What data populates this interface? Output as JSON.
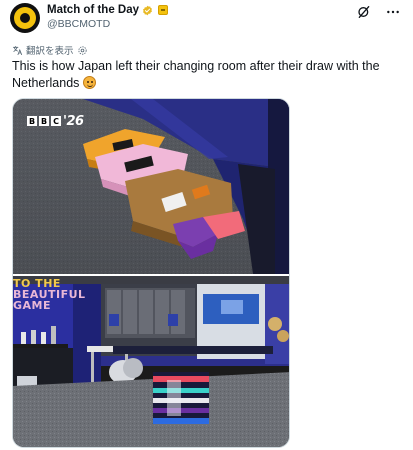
{
  "account": {
    "display_name": "Match of the Day",
    "handle": "@BBCMOTD"
  },
  "translate": {
    "label": "翻訳を表示"
  },
  "post": {
    "text": "This is how Japan left their changing room after their draw with the Netherlands"
  },
  "media": {
    "top_image": {
      "broadcaster_letters": [
        "B",
        "B",
        "C"
      ],
      "tournament_mark": "'26"
    },
    "bottom_image": {
      "banner_line1": "TO THE",
      "banner_line2": "BEAUTIFUL",
      "banner_line3": "GAME"
    }
  },
  "icons": {
    "avatar": "motd-avatar",
    "verified": "verified-badge-icon",
    "affiliate": "affiliate-badge-icon",
    "grok": "grok-icon",
    "more": "more-options-icon",
    "translate": "translate-icon",
    "translate_settings": "settings-icon",
    "emoji": "face-emoji"
  },
  "colors": {
    "accent": "#1d9bf0",
    "text": "#0f1419",
    "muted": "#536471",
    "brand_yellow": "#f4c20d"
  }
}
